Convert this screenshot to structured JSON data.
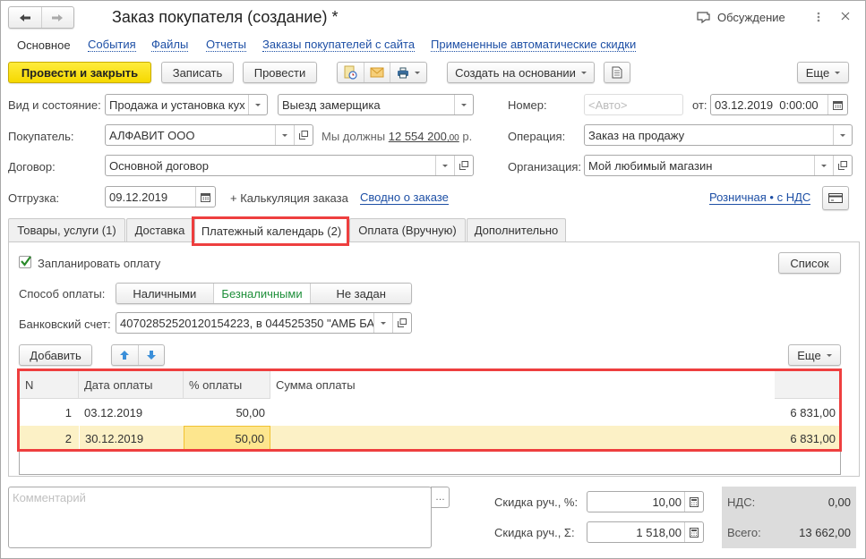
{
  "window": {
    "title": "Заказ покупателя (создание) *",
    "discussion_label": "Обсуждение"
  },
  "nav_links": [
    {
      "label": "Основное",
      "active": true
    },
    {
      "label": "События",
      "active": false
    },
    {
      "label": "Файлы",
      "active": false
    },
    {
      "label": "Отчеты",
      "active": false
    },
    {
      "label": "Заказы покупателей с сайта",
      "active": false
    },
    {
      "label": "Примененные автоматические скидки",
      "active": false
    }
  ],
  "toolbar": {
    "post_close": "Провести и закрыть",
    "save": "Записать",
    "post": "Провести",
    "create_based_on": "Создать на основании",
    "more": "Еще"
  },
  "header_form": {
    "kind_label": "Вид и состояние:",
    "kind_value": "Продажа и установка кух",
    "state_value": "Выезд замерщика",
    "number_label": "Номер:",
    "number_placeholder": "<Авто>",
    "date_from_label": "от:",
    "date_value": "03.12.2019  0:00:00",
    "buyer_label": "Покупатель:",
    "buyer_value": "АЛФАВИТ ООО",
    "debt_prefix": "Мы должны",
    "debt_amount": "12 554 200",
    "debt_cents": ",00",
    "debt_currency": "р.",
    "operation_label": "Операция:",
    "operation_value": "Заказ на продажу",
    "contract_label": "Договор:",
    "contract_value": "Основной договор",
    "org_label": "Организация:",
    "org_value": "Мой любимый магазин",
    "shipment_label": "Отгрузка:",
    "shipment_value": "09.12.2019",
    "calc_link": "+ Калькуляция заказа",
    "summary_link": "Сводно о заказе",
    "price_type_link": "Розничная • с НДС"
  },
  "tabs": [
    {
      "label": "Товары, услуги (1)",
      "active": false
    },
    {
      "label": "Доставка",
      "active": false
    },
    {
      "label": "Платежный календарь (2)",
      "active": true
    },
    {
      "label": "Оплата (Вручную)",
      "active": false
    },
    {
      "label": "Дополнительно",
      "active": false
    }
  ],
  "payment_tab": {
    "plan_payment_label": "Запланировать оплату",
    "plan_payment_checked": true,
    "list_button": "Список",
    "method_label": "Способ оплаты:",
    "methods": [
      {
        "label": "Наличными",
        "selected": false
      },
      {
        "label": "Безналичными",
        "selected": true
      },
      {
        "label": "Не задан",
        "selected": false
      }
    ],
    "bank_account_label": "Банковский счет:",
    "bank_account_value": "40702852520120154223, в 044525350 \"АМБ БА",
    "add_button": "Добавить",
    "more_button": "Еще",
    "table": {
      "columns": [
        "N",
        "Дата оплаты",
        "% оплаты",
        "Сумма оплаты",
        ""
      ],
      "rows": [
        {
          "n": "1",
          "date": "03.12.2019",
          "percent": "50,00",
          "amount": "6 831,00",
          "selected": false
        },
        {
          "n": "2",
          "date": "30.12.2019",
          "percent": "50,00",
          "amount": "6 831,00",
          "selected": true
        }
      ]
    }
  },
  "footer": {
    "comment_placeholder": "Комментарий",
    "discount_pct_label": "Скидка руч., %:",
    "discount_pct_value": "10,00",
    "discount_sum_label": "Скидка руч., Σ:",
    "discount_sum_value": "1 518,00",
    "vat_label": "НДС:",
    "vat_value": "0,00",
    "total_label": "Всего:",
    "total_value": "13 662,00"
  },
  "colors": {
    "accent_yellow": "#f5d800",
    "link_blue": "#1d4fa5",
    "highlight_red": "#ee3f3f",
    "selected_row": "#fcf1c6",
    "selected_cell": "#fde68e",
    "method_selected_green": "#1e8f3a"
  }
}
